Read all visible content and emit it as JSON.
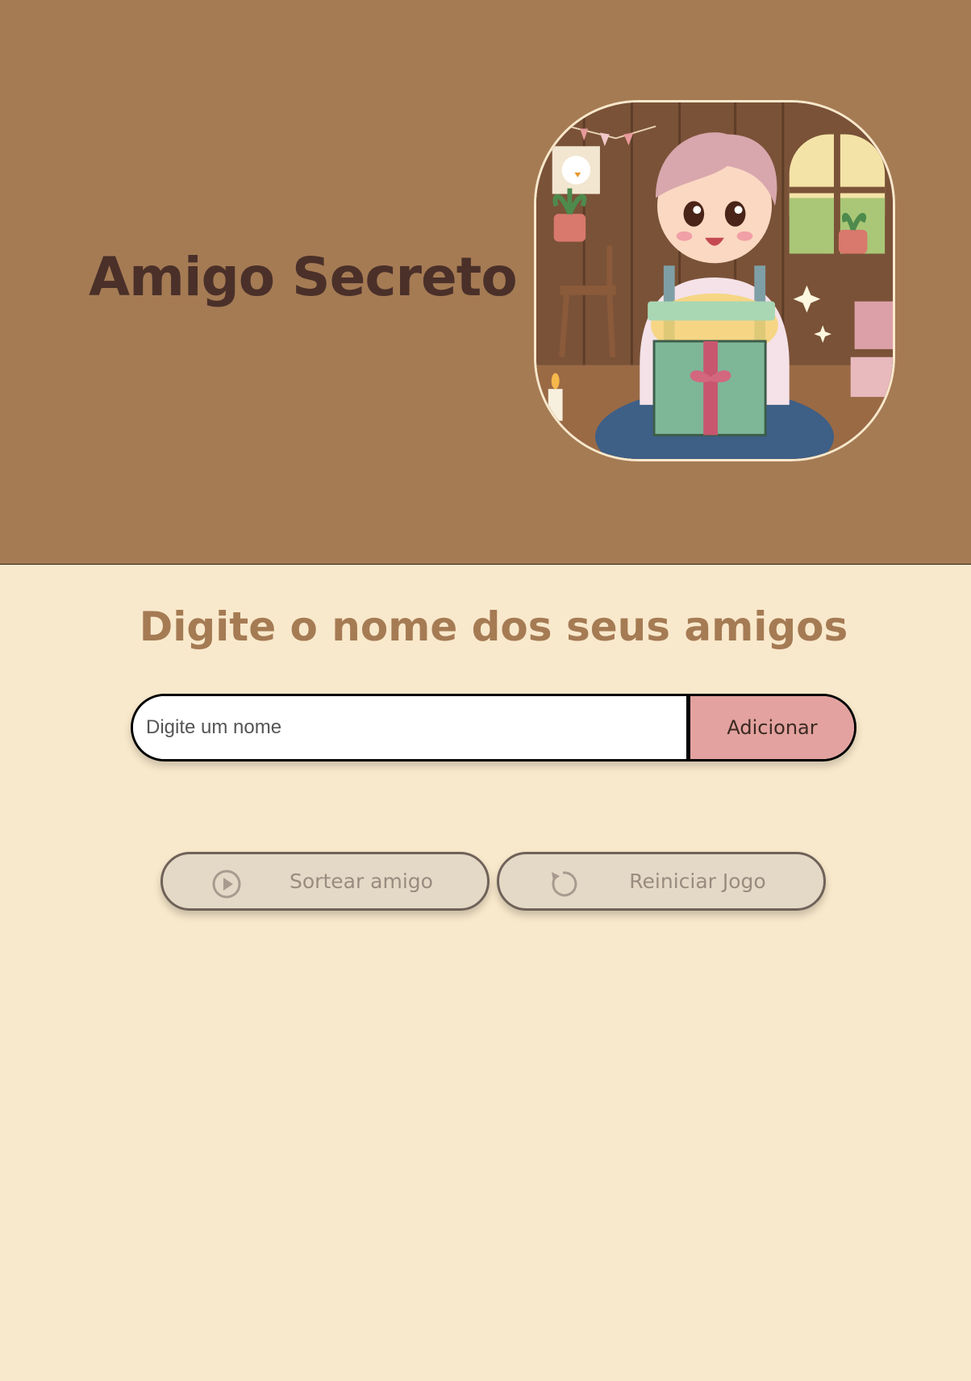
{
  "header": {
    "title": "Amigo Secreto",
    "hero_image": "illustration of a happy child opening a glowing gift box in a cozy wooden room"
  },
  "main": {
    "subtitle": "Digite o nome dos seus amigos",
    "name_input": {
      "placeholder": "Digite um nome",
      "value": ""
    },
    "add_button_label": "Adicionar",
    "draw_button": {
      "label": "Sortear amigo",
      "icon": "play-circle-icon"
    },
    "reset_button": {
      "label": "Reiniciar Jogo",
      "icon": "restart-icon"
    }
  },
  "colors": {
    "header_bg": "#a57b54",
    "page_bg": "#f9e9cc",
    "title": "#4a3029",
    "subtitle": "#a57b54",
    "add_button": "#e3a29f",
    "action_button": "#e4d9c6"
  }
}
